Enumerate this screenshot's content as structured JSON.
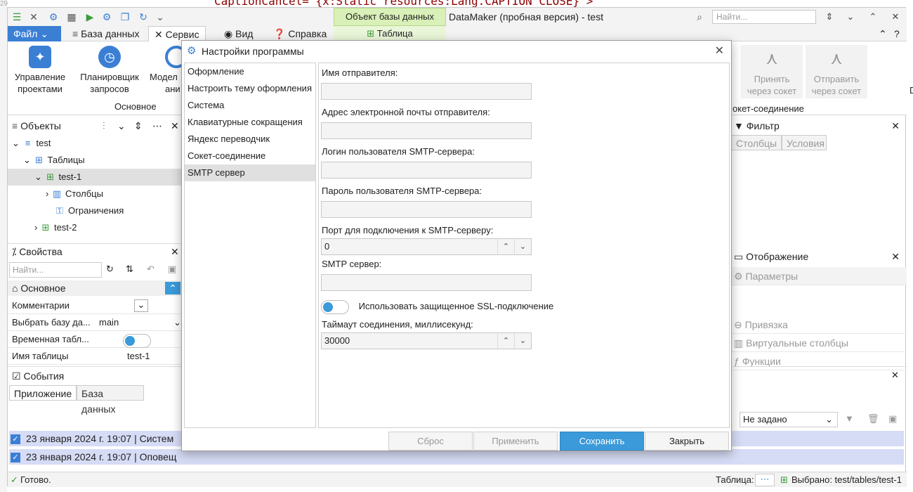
{
  "background_code": "CaptionCancel=\"{x:Static resources:Lang.CAPTION_CLOSE}\">",
  "gutter_line": "29",
  "titlebar": {
    "context_group": "Объект базы данных",
    "context_tab": "Таблица",
    "app_title": "DataMaker (пробная версия) - test",
    "search_placeholder": "Найти..."
  },
  "menu": {
    "file": "Файл",
    "items": [
      "База данных",
      "Сервис",
      "Вид",
      "Справка"
    ],
    "help_icon": "?"
  },
  "ribbon": {
    "buttons": [
      {
        "label_1": "Управление",
        "label_2": "проектами"
      },
      {
        "label_1": "Планировщик",
        "label_2": "запросов"
      },
      {
        "label_1": "Модел",
        "label_2": "ани"
      }
    ],
    "group_main": "Основное",
    "socket_buttons": [
      {
        "label_1": "Принять",
        "label_2": "через сокет"
      },
      {
        "label_1": "Отправить",
        "label_2": "через сокет"
      }
    ],
    "group_socket": "окет-соединение",
    "edge_char": "D"
  },
  "objects": {
    "title": "Объекты",
    "tree": [
      {
        "label": "test"
      },
      {
        "label": "Таблицы"
      },
      {
        "label": "test-1"
      },
      {
        "label": "Столбцы"
      },
      {
        "label": "Ограничения"
      },
      {
        "label": "test-2"
      }
    ]
  },
  "properties": {
    "title": "Свойства",
    "search_placeholder": "Найти...",
    "section": "Основное",
    "rows": [
      {
        "key": "Комментарии",
        "value": ""
      },
      {
        "key": "Выбрать базу да...",
        "value": "main"
      },
      {
        "key": "Временная табл...",
        "value": ""
      },
      {
        "key": "Имя таблицы",
        "value": "test-1"
      }
    ]
  },
  "filter": {
    "title": "Фильтр",
    "tabs": [
      "Столбцы",
      "Условия"
    ]
  },
  "display": {
    "title": "Отображение",
    "items": [
      "Параметры",
      "Привязка",
      "Виртуальные столбцы",
      "Функции"
    ]
  },
  "events": {
    "title": "События",
    "tabs": [
      "Приложение",
      "База данных"
    ],
    "filter_value": "Не задано",
    "rows": [
      "23 января 2024 г. 19:07   |   Систем",
      "23 января 2024 г. 19:07   |   Оповещ"
    ]
  },
  "statusbar": {
    "ready": "Готово.",
    "table_label": "Таблица:",
    "selected": "Выбрано: test/tables/test-1"
  },
  "dialog": {
    "title": "Настройки программы",
    "nav": [
      "Оформление",
      "Настроить тему оформления",
      "Система",
      "Клавиатурные сокращения",
      "Яндекс переводчик",
      "Сокет-соединение",
      "SMTP сервер"
    ],
    "selected_nav": 6,
    "fields": {
      "sender_name": {
        "label": "Имя отправителя:",
        "value": ""
      },
      "sender_email": {
        "label": "Адрес электронной почты отправителя:",
        "value": ""
      },
      "smtp_login": {
        "label": "Логин пользователя SMTP-сервера:",
        "value": ""
      },
      "smtp_password": {
        "label": "Пароль пользователя SMTP-сервера:",
        "value": ""
      },
      "smtp_port": {
        "label": "Порт для подключения к SMTP-серверу:",
        "value": "0"
      },
      "smtp_server": {
        "label": "SMTP сервер:",
        "value": ""
      },
      "ssl": {
        "label": "Использовать защищенное SSL-подключение",
        "on": false
      },
      "timeout": {
        "label": "Таймаут соединения, миллисекунд:",
        "value": "30000"
      }
    },
    "buttons": {
      "reset": "Сброс",
      "apply": "Применить",
      "save": "Сохранить",
      "close": "Закрыть"
    }
  },
  "colors": {
    "accent": "#3b7fd4",
    "primary_button": "#3b9ad9",
    "context_tab": "#d9f0b8",
    "event_row": "#d6dcf5"
  }
}
